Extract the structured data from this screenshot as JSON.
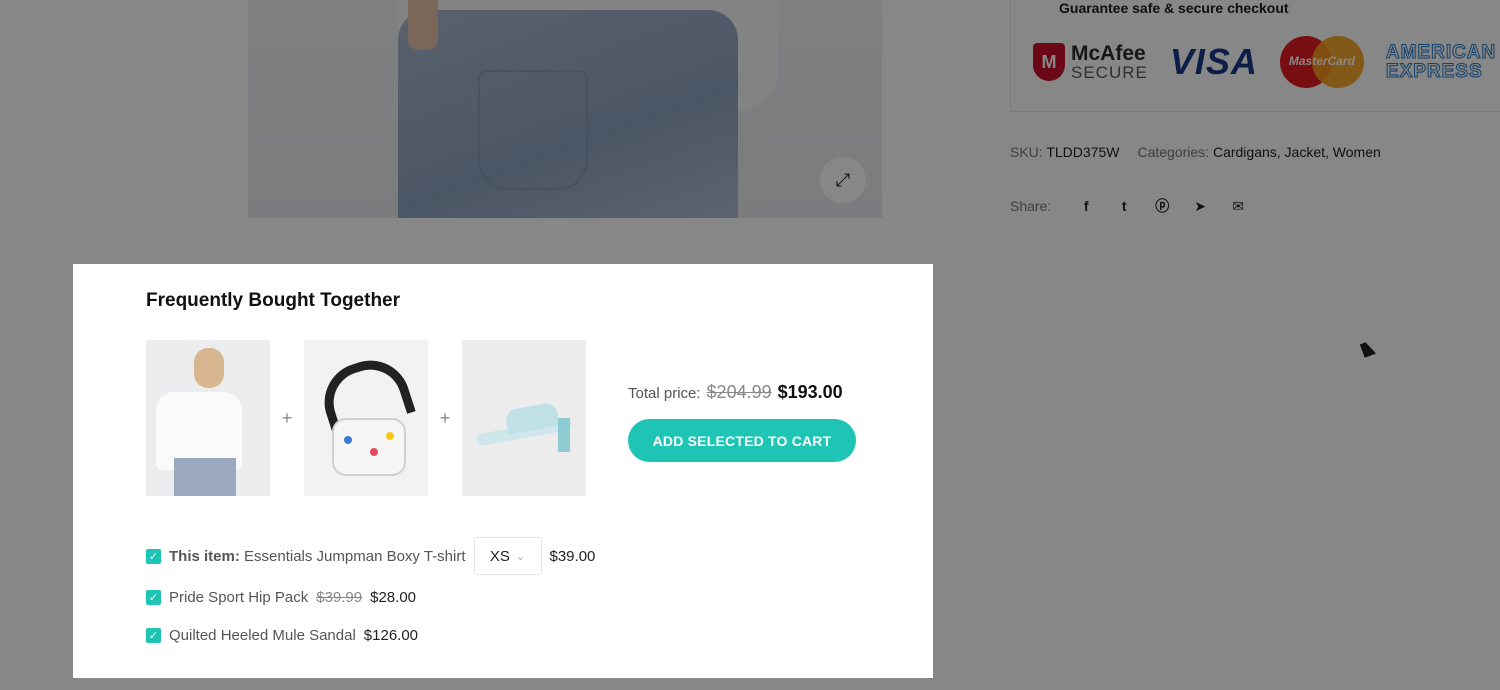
{
  "guarantee": {
    "title": "Guarantee safe & secure checkout"
  },
  "payment_logos": {
    "mcafee_line1": "McAfee",
    "mcafee_line2": "SECURE",
    "mcafee_mark": "M",
    "visa": "VISA",
    "mastercard": "MasterCard",
    "amex_line1": "AMERICAN",
    "amex_line2": "EXPRESS"
  },
  "meta": {
    "sku_label": "SKU:",
    "sku_value": "TLDD375W",
    "categories_label": "Categories:",
    "categories_value": "Cardigans, Jacket, Women"
  },
  "share": {
    "label": "Share:",
    "icons": [
      "facebook-icon",
      "twitter-icon",
      "pinterest-icon",
      "telegram-icon",
      "email-icon"
    ]
  },
  "modal": {
    "title": "Frequently Bought Together",
    "total_label": "Total price:",
    "total_old": "$204.99",
    "total_new": "$193.00",
    "add_button": "ADD SELECTED TO CART",
    "items": [
      {
        "prefix": "This item:",
        "name": "Essentials Jumpman Boxy T-shirt",
        "size": "XS",
        "price": "$39.00",
        "checked": true
      },
      {
        "name": "Pride Sport Hip Pack",
        "old_price": "$39.99",
        "price": "$28.00",
        "checked": true
      },
      {
        "name": "Quilted Heeled Mule Sandal",
        "price": "$126.00",
        "checked": true
      }
    ]
  },
  "colors": {
    "accent": "#1ec4b4",
    "overlay": "rgba(0,0,0,0.47)"
  }
}
